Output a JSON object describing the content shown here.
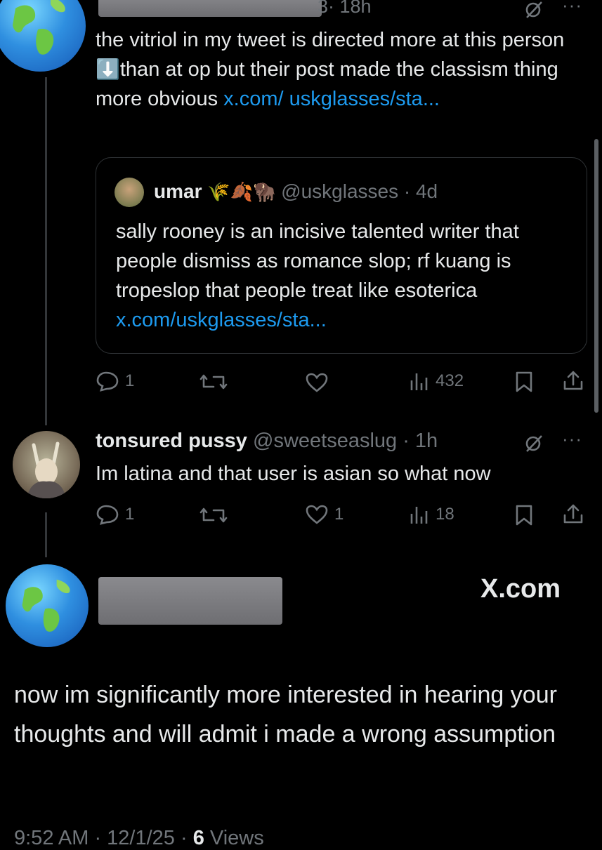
{
  "post1": {
    "time_fragment": "3",
    "time": "· 18h",
    "text_plain": "the vitriol in my tweet is directed more at this person ",
    "emoji": "⬇️",
    "text_after": "than at op but their post made the classism thing more obvious ",
    "link": "x.com/ uskglasses/sta...",
    "more": "···",
    "quote": {
      "name": "umar",
      "emojis": "🌾🍂🦬",
      "handle": "@uskglasses",
      "time": "· 4d",
      "text": "sally rooney is an incisive talented writer that people dismiss as romance slop; rf kuang is tropeslop that people treat like esoterica ",
      "link": "x.com/uskglasses/sta..."
    },
    "actions": {
      "replies": "1",
      "reposts": "",
      "likes": "",
      "views": "432"
    }
  },
  "post2": {
    "name": "tonsured pussy",
    "handle": "@sweetseaslug",
    "time": "· 1h",
    "more": "···",
    "text": "Im latina and that user is asian so what now",
    "actions": {
      "replies": "1",
      "reposts": "",
      "likes": "1",
      "views": "18"
    }
  },
  "main_post": {
    "watermark": "X.com",
    "text": "now im significantly more interested in hearing your thoughts and will admit i made a wrong assumption",
    "footer_time": "9:52 AM · 12/1/25 · ",
    "footer_views_count": "6",
    "footer_views_label": " Views"
  },
  "colors": {
    "background": "#000000",
    "link": "#1d9bf0",
    "muted": "#71767b",
    "text": "#e7e9ea"
  },
  "icons": [
    "globe-avatar",
    "grok-icon",
    "more-icon",
    "reply-icon",
    "repost-icon",
    "like-icon",
    "views-icon",
    "bookmark-icon",
    "share-icon"
  ]
}
